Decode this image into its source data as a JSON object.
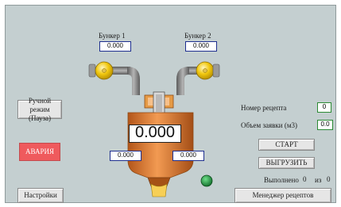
{
  "bunker1": {
    "label": "Бункер 1",
    "value": "0.000"
  },
  "bunker2": {
    "label": "Бункер 2",
    "value": "0.000"
  },
  "mixer": {
    "main_value": "0.000",
    "left_value": "0.000",
    "right_value": "0.000"
  },
  "left_buttons": {
    "manual_mode_line1": "Ручной режим",
    "manual_mode_line2": "(Пауза)",
    "alarm": "АВАРИЯ",
    "settings": "Настройки"
  },
  "recipe": {
    "recipe_number_label": "Номер рецепта",
    "recipe_number_value": "0",
    "order_volume_label": "Объем заявки (м3)",
    "order_volume_value": "0.0",
    "start_label": "СТАРТ",
    "unload_label": "ВЫГРУЗИТЬ",
    "done_label": "Выполнено",
    "done_value": "0",
    "of_label": "из",
    "total_value": "0",
    "manager_label": "Менеджер рецептов"
  },
  "colors": {
    "tank": "#d8711f",
    "valve": "#f2c80f",
    "status_led": "#1c8f3a",
    "alarm": "#ef5a5d"
  },
  "icons": [
    "valve-icon",
    "pipe-icon",
    "mixer-tank-icon",
    "status-led-icon"
  ]
}
